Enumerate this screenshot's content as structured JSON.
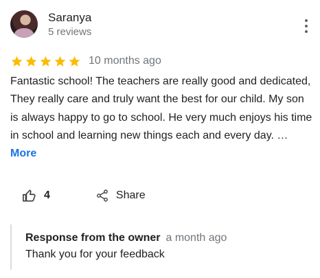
{
  "review": {
    "author_name": "Saranya",
    "author_reviews": "5 reviews",
    "rating": 5,
    "max_rating": 5,
    "time_ago": "10 months ago",
    "text": "Fantastic school! The teachers are really good and dedicated, They really care and truly want the best for our child. My son is always happy to go to school. He very much enjoys his time in school and learning new things each and every day. …",
    "more_label": "More"
  },
  "actions": {
    "like_count": "4",
    "share_label": "Share"
  },
  "owner_response": {
    "title": "Response from the owner",
    "time_ago": "a month ago",
    "text": "Thank you for your feedback"
  },
  "icons": {
    "star": "star-icon",
    "like": "thumb-up-icon",
    "share": "share-icon",
    "menu": "more-vert-icon"
  },
  "colors": {
    "star": "#fbbc04",
    "link": "#1a73e8",
    "secondary_text": "#70757a",
    "primary_text": "#202124"
  }
}
